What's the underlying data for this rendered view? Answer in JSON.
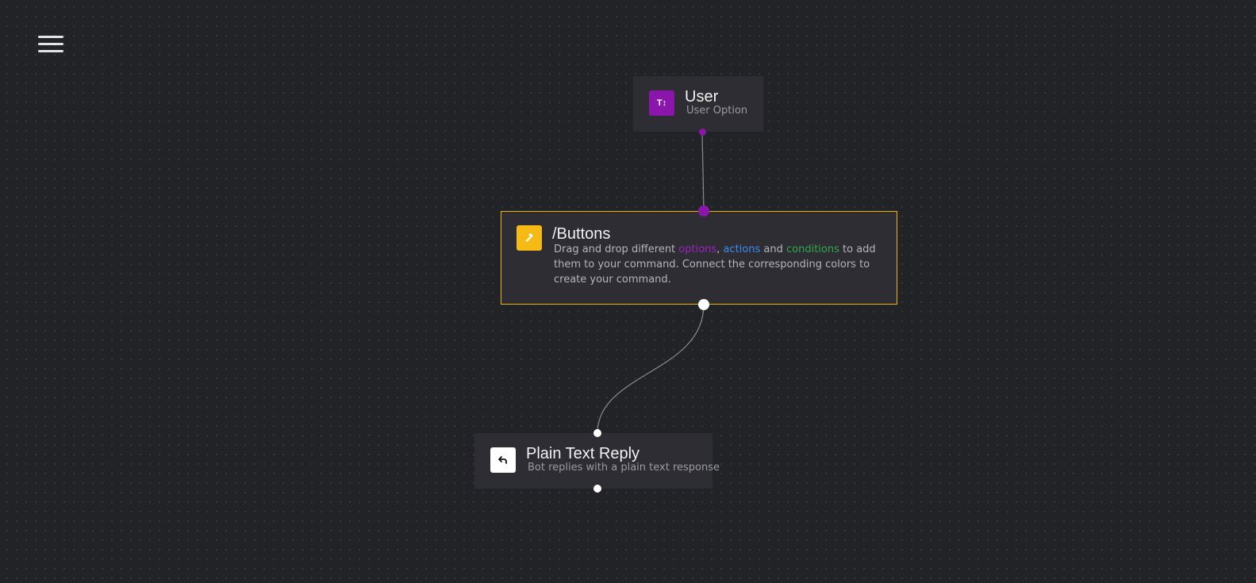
{
  "colors": {
    "background": "#222327",
    "node_background": "#2d2d33",
    "option_purple": "#8b16ab",
    "command_yellow": "#f5bb14",
    "action_blue": "#3a8ef2",
    "condition_green": "#2ea84a"
  },
  "toolbar": {
    "menu_icon": "hamburger-menu-icon"
  },
  "nodes": {
    "user": {
      "icon": "text-option-icon",
      "icon_text": "T↕",
      "title": "User",
      "subtitle": "User Option"
    },
    "command": {
      "icon": "hammer-icon",
      "title": "/Buttons",
      "description": {
        "part1": "Drag and drop different ",
        "options": "options",
        "sep1": ", ",
        "actions": "actions",
        "sep2": " and ",
        "conditions": "conditions",
        "part2": " to add them to your command. Connect the corresponding colors to create your command."
      }
    },
    "reply": {
      "icon": "reply-arrow-icon",
      "title": "Plain Text Reply",
      "subtitle": "Bot replies with a plain text response"
    }
  }
}
